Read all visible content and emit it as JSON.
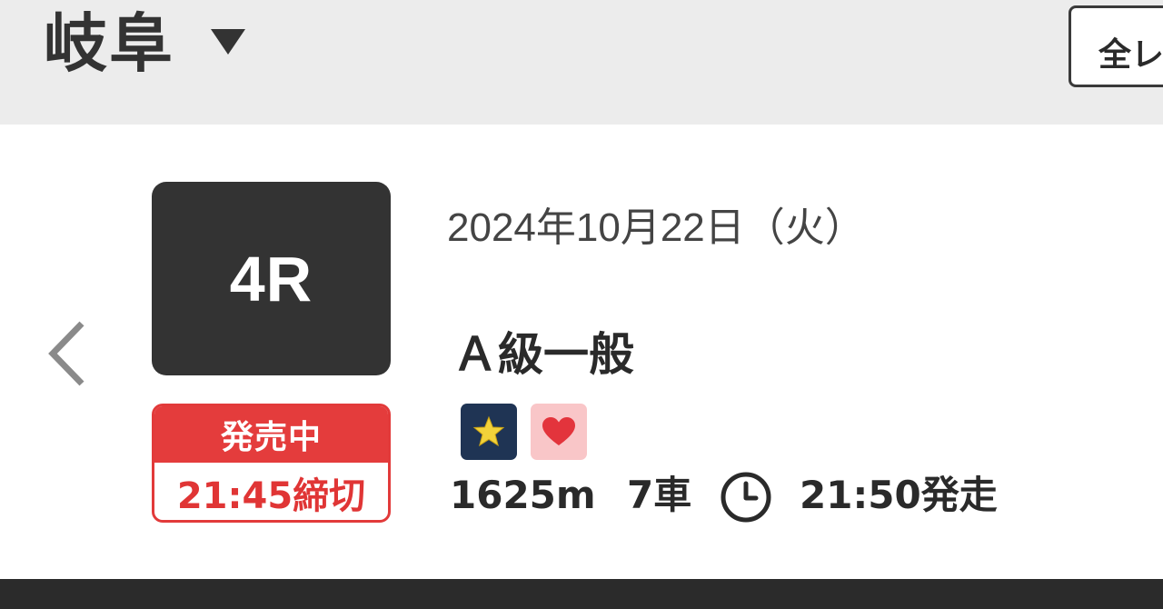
{
  "header": {
    "venue": "岐阜",
    "all_races_label": "全レ"
  },
  "race": {
    "number": "4R",
    "date": "2024年10月22日（火）",
    "class": "Ａ級一般",
    "sale_status": "発売中",
    "deadline": "21:45締切",
    "distance": "1625m",
    "cars": "7車",
    "start_time": "21:50発走"
  },
  "icons": {
    "venue_dropdown": "caret-down-icon",
    "previous_race": "chevron-left-icon",
    "star_badge": "star-icon",
    "heart_badge": "heart-icon",
    "start_time": "clock-icon"
  },
  "colors": {
    "race_number_bg": "#333333",
    "sale_red": "#e43c3c",
    "star_badge_bg": "#1f3454",
    "star_fill": "#f2d23a",
    "heart_badge_bg": "#f9c6c8",
    "heart_fill": "#e3343c"
  }
}
